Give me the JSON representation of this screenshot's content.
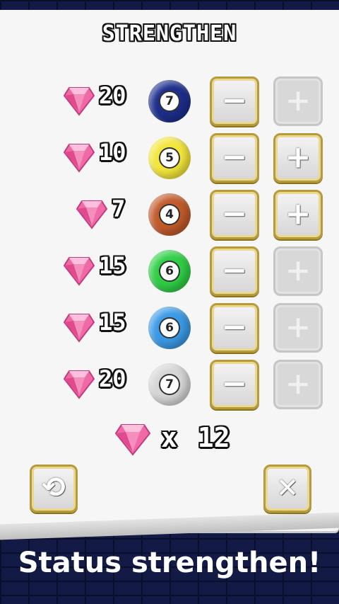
{
  "screen": {
    "title": "STRENGTHEN",
    "caption": "Status strengthen!"
  },
  "rows": [
    {
      "cost": "20",
      "orb_level": "7",
      "orb_icon": "bars-icon",
      "orb_color": "#1d2e8c",
      "plus_enabled": false
    },
    {
      "cost": "10",
      "orb_level": "5",
      "orb_icon": "coin-icon",
      "orb_color": "#f3e63b",
      "plus_enabled": true
    },
    {
      "cost": "7",
      "orb_level": "4",
      "orb_icon": "football-icon",
      "orb_color": "#c25a2a",
      "plus_enabled": true
    },
    {
      "cost": "15",
      "orb_level": "6",
      "orb_icon": "potion-icon",
      "orb_color": "#2fcf45",
      "plus_enabled": false
    },
    {
      "cost": "15",
      "orb_level": "6",
      "orb_icon": "sword-icon",
      "orb_color": "#3a9ae6",
      "plus_enabled": false
    },
    {
      "cost": "20",
      "orb_level": "7",
      "orb_icon": "knight-icon",
      "orb_color": "#d6d6d6",
      "plus_enabled": false
    }
  ],
  "buttons": {
    "minus_glyph": "−",
    "plus_glyph": "+",
    "reset_glyph": "⟲",
    "close_glyph": "✕"
  },
  "gems": {
    "multiplier": "x",
    "count": "12"
  },
  "colors": {
    "gem": "#f06aa8",
    "gold_border": "#b79a3b",
    "panel": "#f6f6f6"
  }
}
